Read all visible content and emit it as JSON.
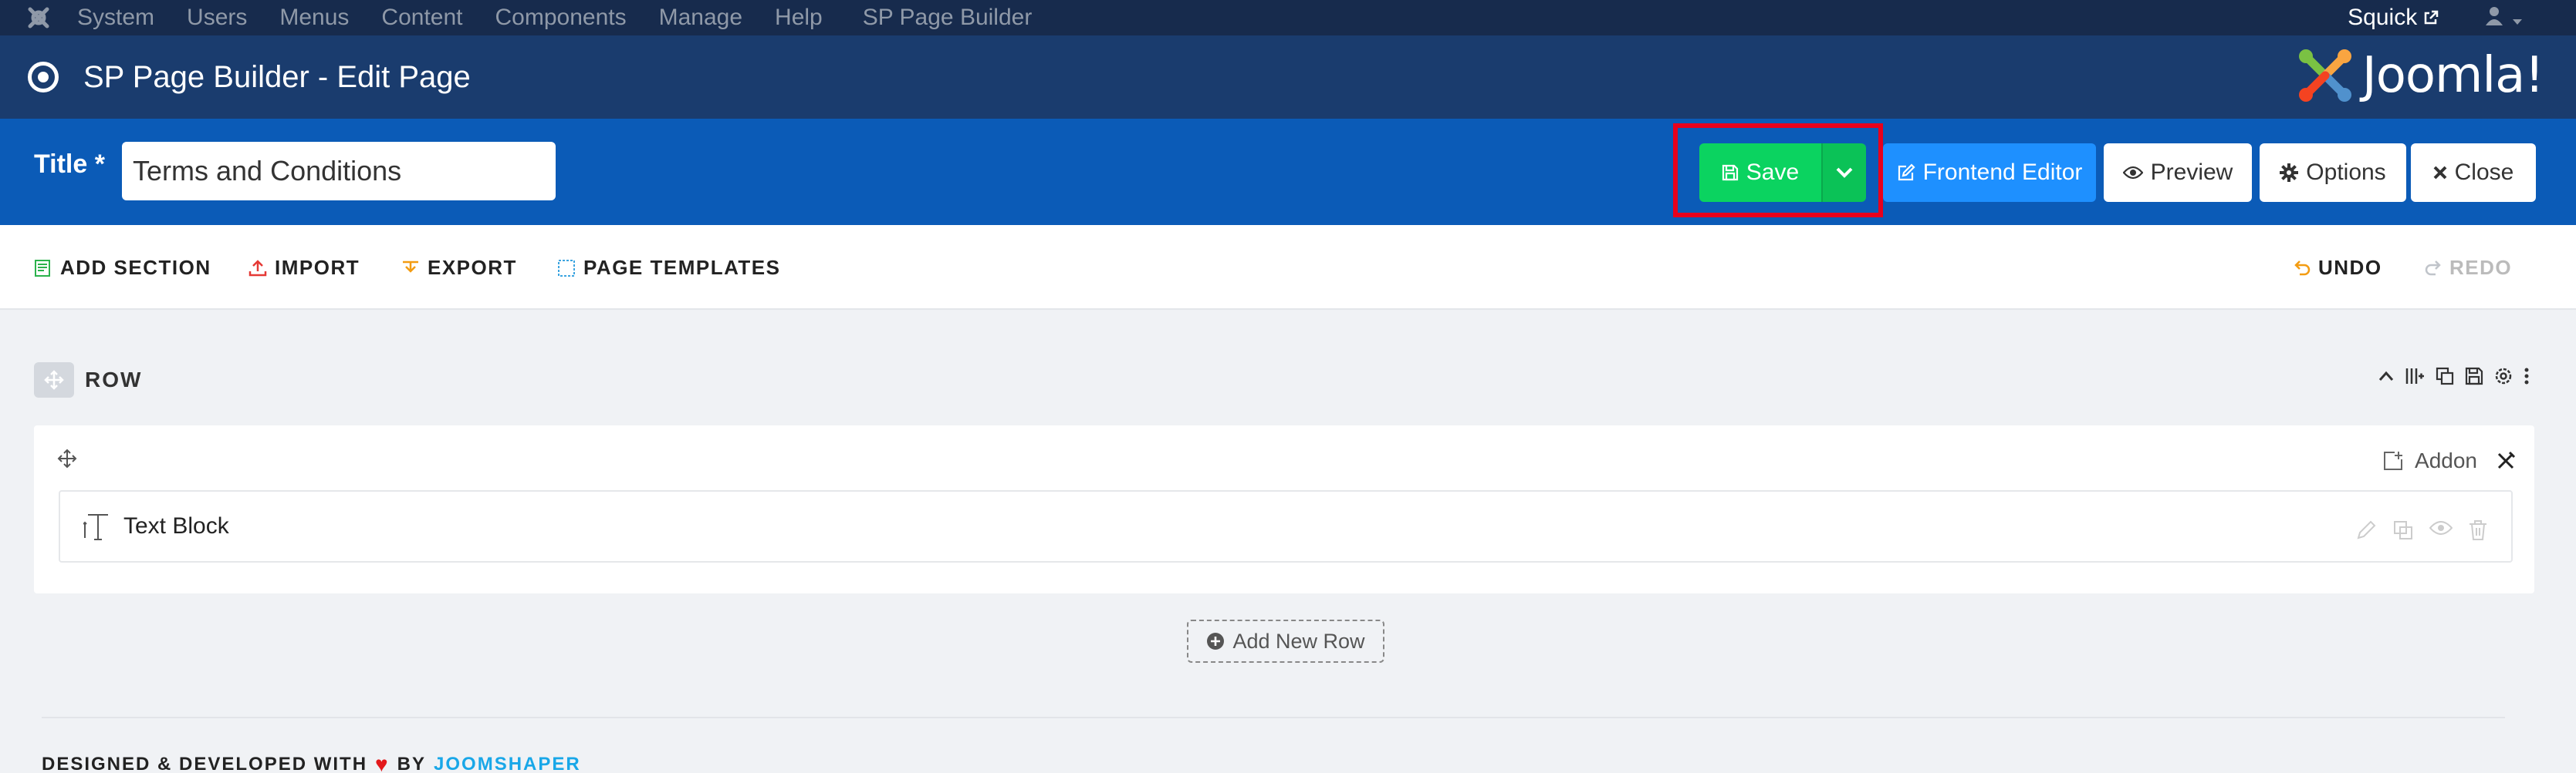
{
  "topbar": {
    "menu": [
      "System",
      "Users",
      "Menus",
      "Content",
      "Components",
      "Manage",
      "Help",
      "SP Page Builder"
    ],
    "site_name": "Squick"
  },
  "header": {
    "page_title": "SP Page Builder - Edit Page",
    "brand": "Joomla!"
  },
  "titlebar": {
    "label": "Title *",
    "title_value": "Terms and Conditions",
    "buttons": {
      "save": "Save",
      "frontend_editor": "Frontend Editor",
      "preview": "Preview",
      "options": "Options",
      "close": "Close"
    }
  },
  "toolbar": {
    "add_section": "ADD SECTION",
    "import": "IMPORT",
    "export": "EXPORT",
    "page_templates": "PAGE TEMPLATES",
    "undo": "UNDO",
    "redo": "REDO"
  },
  "row": {
    "label": "ROW",
    "addon_label": "Addon",
    "addons": [
      {
        "name": "Text Block"
      }
    ]
  },
  "add_new_row": "Add New Row",
  "footer": {
    "prefix": "DESIGNED & DEVELOPED WITH",
    "by": "BY",
    "company": "JOOMSHAPER"
  },
  "colors": {
    "topbar": "#172b4d",
    "header": "#1a3c6e",
    "titlebar": "#0b5bb7",
    "save": "#0bd360",
    "frontend": "#1e90ff",
    "highlight": "#e8001c"
  }
}
